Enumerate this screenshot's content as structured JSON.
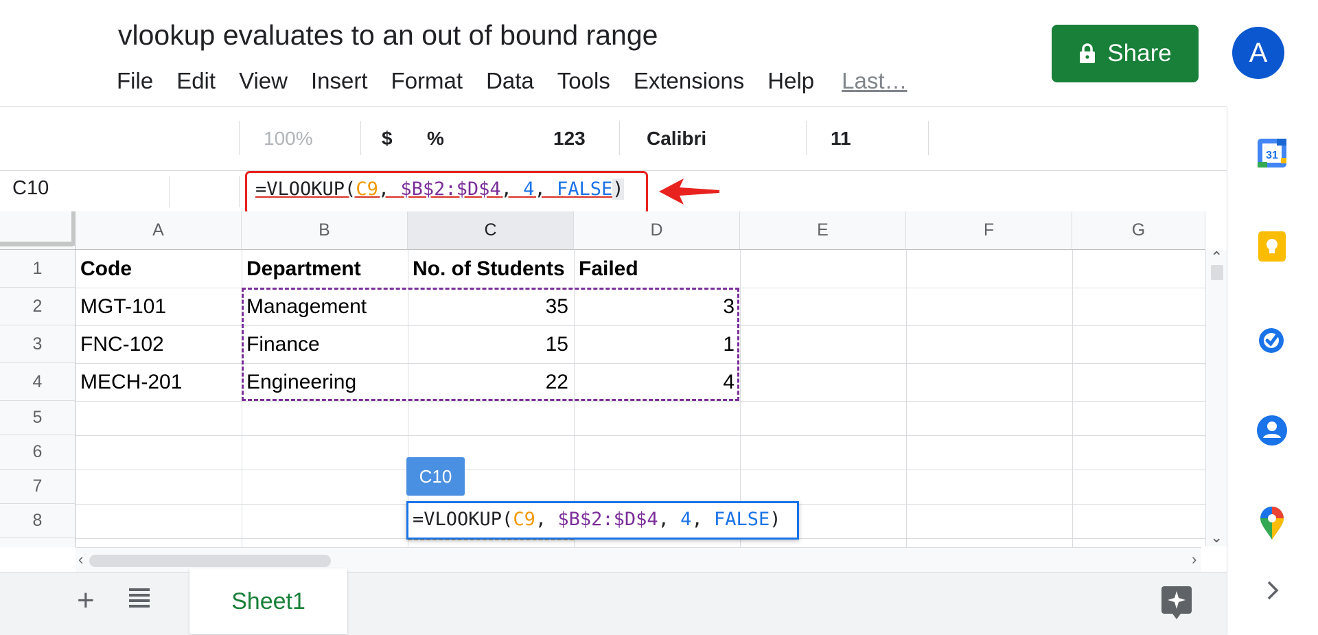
{
  "document": {
    "title": "vlookup evaluates to an out of bound range"
  },
  "menu": {
    "items": [
      "File",
      "Edit",
      "View",
      "Insert",
      "Format",
      "Data",
      "Tools",
      "Extensions",
      "Help"
    ],
    "last_edit": "Last…"
  },
  "share": {
    "label": "Share",
    "color": "#188038"
  },
  "user": {
    "avatar_initial": "A"
  },
  "toolbar": {
    "zoom": "100%",
    "currency": "$",
    "percent": "%",
    "number_format": "123",
    "font": "Calibri",
    "font_size": "11"
  },
  "formula_bar": {
    "name_box": "C10",
    "formula_parts": {
      "eq": "=VLOOKUP(",
      "ref1": "C9",
      "sep1": ", ",
      "ref2": "$B$2:$D$4",
      "sep2": ", ",
      "num": "4",
      "sep3": ", ",
      "bool": "FALSE",
      "close": ")"
    }
  },
  "grid": {
    "columns": [
      "A",
      "B",
      "C",
      "D",
      "E",
      "F",
      "G"
    ],
    "rows": [
      "1",
      "2",
      "3",
      "4",
      "5",
      "6",
      "7",
      "8"
    ],
    "cells": {
      "A1": "Code",
      "B1": "Department",
      "C1": "No. of Students",
      "D1": "Failed",
      "A2": "MGT-101",
      "B2": "Management",
      "C2": "35",
      "D2": "3",
      "A3": "FNC-102",
      "B3": "Finance",
      "C3": "15",
      "D3": "1",
      "A4": "MECH-201",
      "B4": "Engineering",
      "C4": "22",
      "D4": "4"
    },
    "active_cell_tag": "C10",
    "editor_formula_parts": {
      "eq": "=VLOOKUP(",
      "ref1": "C9",
      "sep1": ", ",
      "ref2": "$B$2:$D$4",
      "sep2": ", ",
      "num": "4",
      "sep3": ", ",
      "bool": "FALSE",
      "close": ")"
    }
  },
  "sheets": {
    "tabs": [
      {
        "label": "Sheet1"
      }
    ]
  },
  "side_panel": {
    "icons": [
      "calendar-icon",
      "keep-icon",
      "tasks-icon",
      "contacts-icon",
      "maps-icon",
      "expand-icon"
    ],
    "calendar_day": "31"
  },
  "icons": {
    "share": "lock-icon",
    "add_sheet": "plus-icon",
    "all_sheets": "list-icon",
    "explore": "explore-icon",
    "annotation": "red-arrow-icon"
  },
  "colors": {
    "ref1": "#f29900",
    "ref2": "#7b2d99",
    "num": "#1a73e8",
    "annotation": "#e8221e"
  }
}
